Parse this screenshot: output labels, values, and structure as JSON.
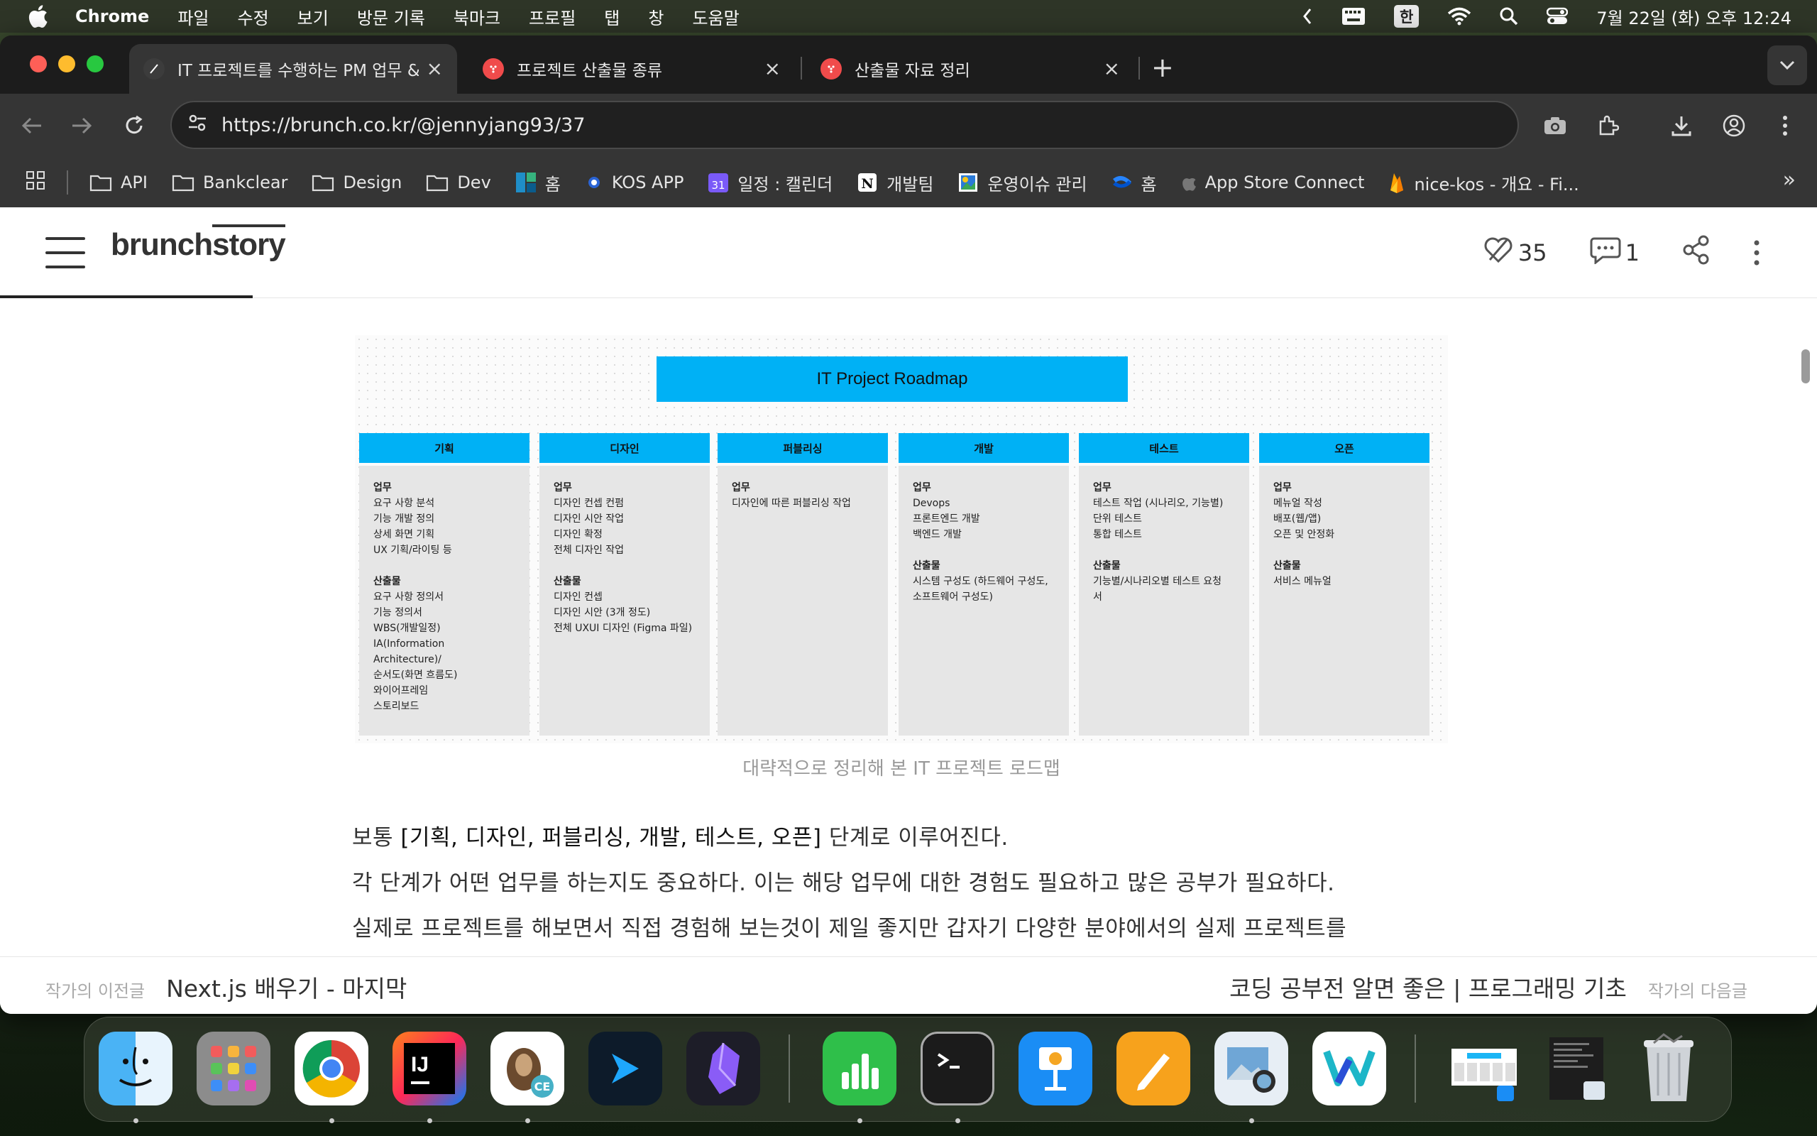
{
  "menubar": {
    "app_name": "Chrome",
    "items": [
      "파일",
      "수정",
      "보기",
      "방문 기록",
      "북마크",
      "프로필",
      "탭",
      "창",
      "도움말"
    ],
    "ime": "한",
    "clock": "7월 22일 (화) 오후 12:24"
  },
  "tabs": [
    {
      "title": "IT 프로젝트를 수행하는 PM 업무 &",
      "favicon_color": "#3c3c3c",
      "active": true
    },
    {
      "title": "프로젝트 산출물 종류",
      "favicon_color": "#f04b4b",
      "active": false
    },
    {
      "title": "산출물 자료 정리",
      "favicon_color": "#f04b4b",
      "active": false
    }
  ],
  "omnibox": {
    "url": "https://brunch.co.kr/@jennyjang93/37"
  },
  "bookmarks": [
    {
      "label": "API",
      "icon": "folder-icon"
    },
    {
      "label": "Bankclear",
      "icon": "folder-icon"
    },
    {
      "label": "Design",
      "icon": "folder-icon"
    },
    {
      "label": "Dev",
      "icon": "folder-icon"
    },
    {
      "label": "홈",
      "icon": "jira-icon"
    },
    {
      "label": "KOS APP",
      "icon": "app-icon"
    },
    {
      "label": "일정 : 캘린더",
      "icon": "calendar-icon"
    },
    {
      "label": "개발팀",
      "icon": "notion-icon"
    },
    {
      "label": "운영이슈 관리",
      "icon": "sheet-icon"
    },
    {
      "label": "홈",
      "icon": "confluence-icon"
    },
    {
      "label": "App Store Connect",
      "icon": "apple-icon"
    },
    {
      "label": "nice-kos - 개요 - Fi...",
      "icon": "firebase-icon"
    }
  ],
  "site": {
    "logo_a": "brunch",
    "logo_b": "story",
    "likes": "35",
    "comments": "1"
  },
  "roadmap": {
    "title": "IT Project Roadmap",
    "phases": [
      {
        "name": "기획",
        "work_title": "업무",
        "work": [
          "요구 사항 분석",
          "기능 개발 정의",
          "상세 화면 기획",
          "UX 기획/라이팅 등"
        ],
        "out_title": "산출물",
        "outputs": [
          "요구 사항 정의서",
          "기능 정의서",
          "WBS(개발일정)",
          "IA(Information Architecture)/",
          "순서도(화면 흐름도)",
          "와이어프레임",
          "스토리보드"
        ]
      },
      {
        "name": "디자인",
        "work_title": "업무",
        "work": [
          "디자인 컨셉 컨펌",
          "디자인 시안 작업",
          "디자인 확정",
          "전체 디자인 작업"
        ],
        "out_title": "산출물",
        "outputs": [
          "디자인 컨셉",
          "디자인 시안 (3개 정도)",
          "전체 UXUI 디자인 (Figma 파일)"
        ]
      },
      {
        "name": "퍼블리싱",
        "work_title": "업무",
        "work": [
          "디자인에 따른 퍼블리싱 작업"
        ],
        "out_title": "",
        "outputs": []
      },
      {
        "name": "개발",
        "work_title": "업무",
        "work": [
          "Devops",
          "프론트엔드 개발",
          "백엔드 개발"
        ],
        "out_title": "산출물",
        "outputs": [
          "시스템 구성도 (하드웨어 구성도,",
          "소프트웨어 구성도)"
        ]
      },
      {
        "name": "테스트",
        "work_title": "업무",
        "work": [
          "테스트 작업 (시나리오, 기능별)",
          "단위 테스트",
          "통합 테스트"
        ],
        "out_title": "산출물",
        "outputs": [
          "기능별/시나리오별 테스트 요청",
          "서"
        ]
      },
      {
        "name": "오픈",
        "work_title": "업무",
        "work": [
          "메뉴얼 작성",
          "배포(웹/앱)",
          "오픈 및 안정화"
        ],
        "out_title": "산출물",
        "outputs": [
          "서비스 메뉴얼"
        ]
      }
    ],
    "caption": "대략적으로 정리해 본 IT 프로젝트 로드맵"
  },
  "article": {
    "line1_pre": "보통 ",
    "line1_bold": "[기획, 디자인, 퍼블리싱, 개발, 테스트, 오픈]",
    "line1_post": " 단계로 이루어진다.",
    "line2": "각 단계가 어떤 업무를 하는지도 중요하다. 이는 해당 업무에 대한 경험도 필요하고 많은 공부가 필요하다.",
    "line3": "실제로 프로젝트를 해보면서 직접 경험해 보는것이 제일 좋지만 갑자기 다양한 분야에서의 실제 프로젝트를"
  },
  "postnav": {
    "prev_label": "작가의 이전글",
    "prev_title": "Next.js 배우기 - 마지막",
    "next_title": "코딩 공부전 알면 좋은 | 프로그래밍 기초",
    "next_label": "작가의 다음글"
  },
  "dock": {
    "apps": [
      "finder-icon",
      "launchpad-icon",
      "chrome-icon",
      "intellij-icon",
      "dbeaver-icon",
      "xcode-cloud-icon",
      "obsidian-icon",
      "numbers-icon",
      "terminal-icon",
      "keynote-icon",
      "pages-icon",
      "preview-icon",
      "naver-whale-icon"
    ]
  }
}
